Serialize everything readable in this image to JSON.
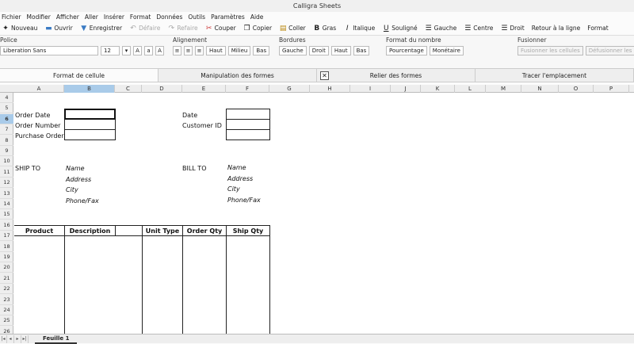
{
  "window": {
    "title": "Calligra Sheets"
  },
  "menu": [
    "Fichier",
    "Modifier",
    "Afficher",
    "Aller",
    "Insérer",
    "Format",
    "Données",
    "Outils",
    "Paramètres",
    "Aide"
  ],
  "toolbar": {
    "new": "Nouveau",
    "open": "Ouvrir",
    "save": "Enregistrer",
    "undo": "Défaire",
    "redo": "Refaire",
    "cut": "Couper",
    "copy": "Copier",
    "paste": "Coller",
    "bold": "Gras",
    "italic": "Italique",
    "underline": "Souligné",
    "left": "Gauche",
    "center": "Centre",
    "right": "Droit",
    "wrap": "Retour à la ligne",
    "format": "Format"
  },
  "ribbon": {
    "font_group": "Police",
    "font_name": "Liberation Sans",
    "font_size": "12",
    "align_group": "Alignement",
    "align_top": "Haut",
    "align_middle": "Milieu",
    "align_bottom": "Bas",
    "borders_group": "Bordures",
    "b_left": "Gauche",
    "b_right": "Droit",
    "b_top": "Haut",
    "b_bottom": "Bas",
    "numfmt_group": "Format du nombre",
    "percent": "Pourcentage",
    "money": "Monétaire",
    "merge_group": "Fusionner",
    "merge_cells": "Fusionner les cellules",
    "unmerge_cells": "Défusionner les cellules"
  },
  "tabs": [
    "Format de cellule",
    "Manipulation des formes",
    "Relier des formes",
    "Tracer l'emplacement"
  ],
  "columns": [
    "A",
    "B",
    "C",
    "D",
    "E",
    "F",
    "G",
    "H",
    "I",
    "J",
    "K",
    "L",
    "M",
    "N",
    "O",
    "P"
  ],
  "rows": [
    "4",
    "5",
    "6",
    "7",
    "8",
    "9",
    "10",
    "11",
    "12",
    "13",
    "14",
    "15",
    "16",
    "17",
    "18",
    "19",
    "20",
    "21",
    "22",
    "23",
    "24",
    "25",
    "26",
    "27",
    "28"
  ],
  "sheet": {
    "order_date": "Order Date",
    "order_number": "Order Number",
    "purchase_order": "Purchase Order",
    "date": "Date",
    "customer_id": "Customer ID",
    "ship_to": "SHIP TO",
    "bill_to": "BILL TO",
    "ship": {
      "name": "Name",
      "address": "Address",
      "city": "City",
      "phone": "Phone/Fax"
    },
    "bill": {
      "name": "Name",
      "address": "Address",
      "city": "City",
      "phone": "Phone/Fax"
    },
    "headers": {
      "product": "Product",
      "description": "Description",
      "unit_type": "Unit Type",
      "order_qty": "Order Qty",
      "ship_qty": "Ship Qty"
    }
  },
  "sheet_tab": "Feuille 1"
}
